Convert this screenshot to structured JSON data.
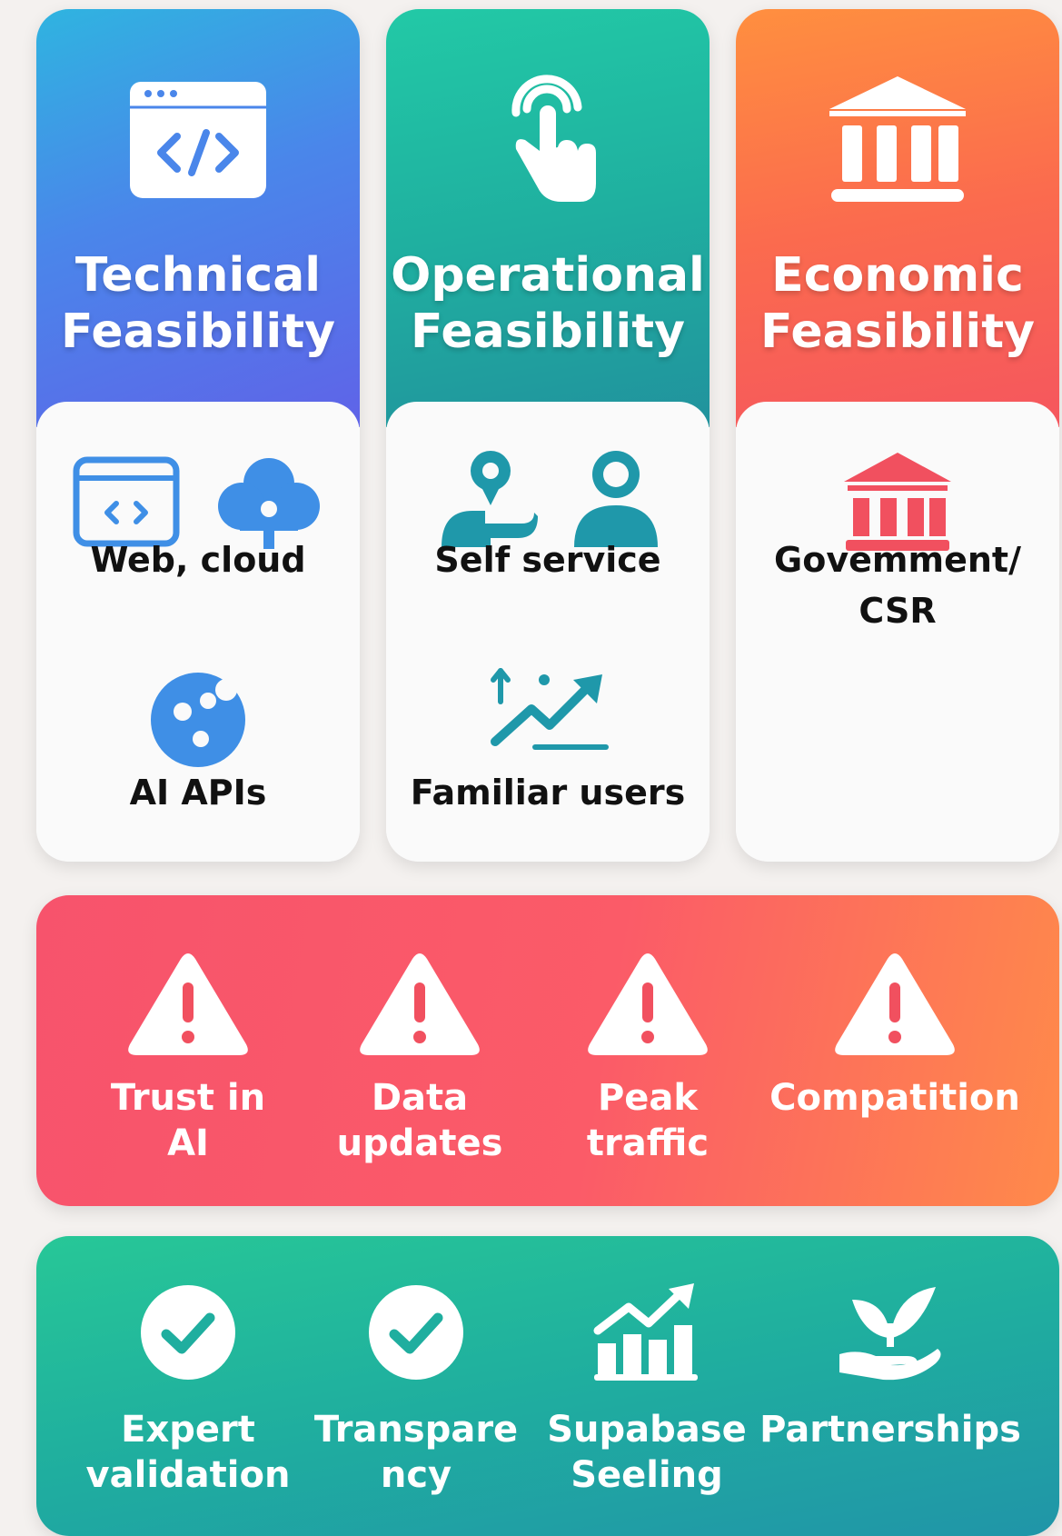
{
  "columns": [
    {
      "title_line1": "Technical",
      "title_line2": "Feasibility",
      "head_icon": "code-window-icon",
      "features": [
        {
          "label": "Web, cloud",
          "icons": [
            "code-window-icon",
            "cloud-icon"
          ]
        },
        {
          "label": "AI APIs",
          "icons": [
            "globe-icon"
          ]
        }
      ]
    },
    {
      "title_line1": "Operational",
      "title_line2": "Feasibility",
      "head_icon": "tap-hand-icon",
      "features": [
        {
          "label": "Self service",
          "icons": [
            "user-pin-icon",
            "user-icon"
          ]
        },
        {
          "label": "Familiar users",
          "icons": [
            "trend-up-icon"
          ]
        }
      ]
    },
    {
      "title_line1": "Economic",
      "title_line2": "Feasibility",
      "head_icon": "bank-icon",
      "features": [
        {
          "label_line1": "Govemment/",
          "label_line2": "CSR",
          "icons": [
            "bank-icon"
          ]
        }
      ]
    }
  ],
  "risks": [
    {
      "line1": "Trust in",
      "line2": "AI",
      "icon": "warning-icon"
    },
    {
      "line1": "Data",
      "line2": "updates",
      "icon": "warning-icon"
    },
    {
      "line1": "Peak",
      "line2": "traffic",
      "icon": "warning-icon"
    },
    {
      "line1": "Compatition",
      "line2": "",
      "icon": "warning-icon"
    }
  ],
  "mitigations": [
    {
      "line1": "Expert",
      "line2": "validation",
      "icon": "check-circle-icon"
    },
    {
      "line1": "Transpare",
      "line2": "ncy",
      "icon": "check-circle-icon"
    },
    {
      "line1": "Supabase",
      "line2": "Seeling",
      "icon": "growth-chart-icon"
    },
    {
      "line1": "Partnerships",
      "line2": "",
      "icon": "sprout-hand-icon"
    }
  ],
  "colors": {
    "tech_accent": "#3f8fe6",
    "ops_accent": "#1f98aa",
    "eco_accent": "#f1505f",
    "risk_band": "#f7536c",
    "mitigation_band": "#1fae9f"
  }
}
